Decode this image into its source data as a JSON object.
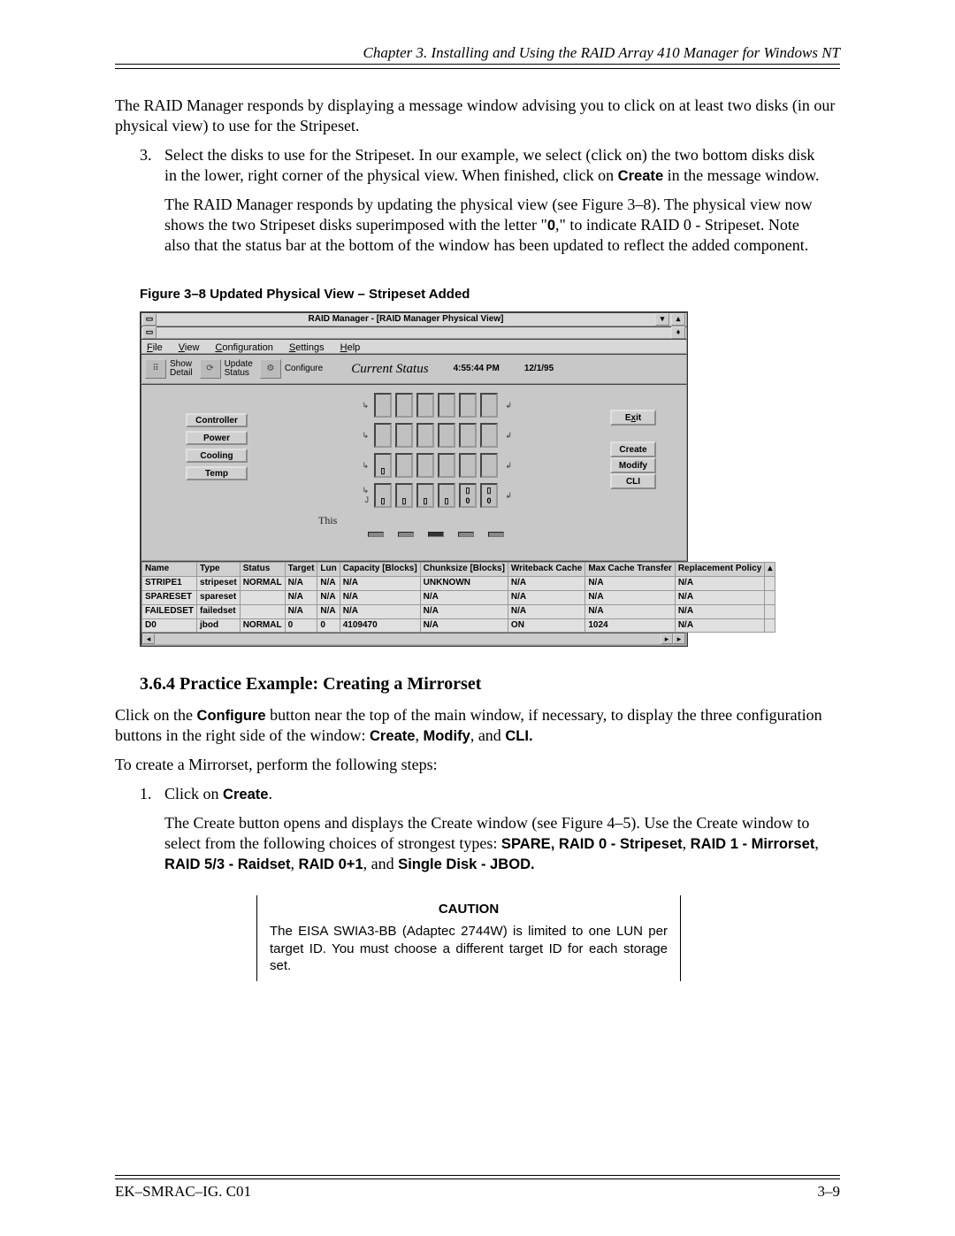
{
  "header": "Chapter 3.  Installing and Using the RAID Array 410 Manager for Windows NT",
  "intro_para1": "The RAID Manager responds by displaying a message window advising you to click on at least two disks (in our physical view) to use for the Stripeset.",
  "step3_text_a": "Select the disks to use for the Stripeset. In our example, we select (click on) the two bottom disks disk in the lower, right corner of the physical view. When finished, click on ",
  "step3_bold": "Create",
  "step3_text_b": " in the message window.",
  "step3_para2_a": "The RAID Manager responds by updating the physical view (see Figure 3–8). The physical view now shows the two Stripeset disks superimposed with the letter \"",
  "step3_para2_bold": "0",
  "step3_para2_b": ",\" to indicate RAID 0 - Stripeset. Note also that the status bar at the bottom of the window has been updated to reflect the added component.",
  "fig_caption": "Figure 3–8  Updated Physical View – Stripeset Added",
  "section_heading": "3.6.4    Practice Example: Creating a Mirrorset",
  "p1_a": "Click on the ",
  "p1_bold": "Configure",
  "p1_b": " button near the top of the main window, if necessary, to display the three configuration buttons in the right side of the window: ",
  "p1_bold2": "Create",
  "p1_comma": ", ",
  "p1_bold3": "Modify",
  "p1_and": ", and ",
  "p1_bold4": "CLI.",
  "p2": "To create a Mirrorset, perform the following steps:",
  "step1_a": "Click on ",
  "step1_bold": "Create",
  "step1_b": ".",
  "step1_para2_a": "The Create button opens and displays the Create window (see Figure 4–5). Use the Create window to select from the following choices of strongest types: ",
  "step1_para2_bold": "SPARE, RAID 0 - Stripeset",
  "step1_para2_sep1": ", ",
  "step1_para2_b2": "RAID 1 - Mirrorset",
  "step1_para2_sep2": ", ",
  "step1_para2_b3": "RAID 5/3 - Raidset",
  "step1_para2_sep3": ", ",
  "step1_para2_b4": "RAID 0+1",
  "step1_para2_sep4": ", and ",
  "step1_para2_b5": "Single Disk - JBOD.",
  "caution_title": "CAUTION",
  "caution_body": "The EISA SWIA3-BB (Adaptec 2744W) is limited to one LUN per target ID. You must choose a different target ID for each storage set.",
  "footer_left": "EK–SMRAC–IG. C01",
  "footer_right": "3–9",
  "screenshot": {
    "window_title": "RAID Manager  -  [RAID Manager Physical View]",
    "menus": {
      "file": "File",
      "view": "View",
      "config": "Configuration",
      "settings": "Settings",
      "help": "Help"
    },
    "toolbar": {
      "show_detail": "Show\nDetail",
      "update_status": "Update\nStatus",
      "configure": "Configure",
      "current_status": "Current Status",
      "time": "4:55:44 PM",
      "date": "12/1/95"
    },
    "left_buttons": {
      "controller": "Controller",
      "power": "Power",
      "cooling": "Cooling",
      "temp": "Temp"
    },
    "right_buttons": {
      "exit": "Exit",
      "create": "Create",
      "modify": "Modify",
      "cli": "CLI"
    },
    "this_label": "This",
    "table": {
      "headers": [
        "Name",
        "Type",
        "Status",
        "Target",
        "Lun",
        "Capacity [Blocks]",
        "Chunksize [Blocks]",
        "Writeback Cache",
        "Max Cache Transfer",
        "Replacement Policy"
      ],
      "rows": [
        [
          "STRIPE1",
          "stripeset",
          "NORMAL",
          "N/A",
          "N/A",
          "N/A",
          "UNKNOWN",
          "N/A",
          "N/A",
          "N/A"
        ],
        [
          "SPARESET",
          "spareset",
          "",
          "N/A",
          "N/A",
          "N/A",
          "N/A",
          "N/A",
          "N/A",
          "N/A"
        ],
        [
          "FAILEDSET",
          "failedset",
          "",
          "N/A",
          "N/A",
          "N/A",
          "N/A",
          "N/A",
          "N/A",
          "N/A"
        ],
        [
          "D0",
          "jbod",
          "NORMAL",
          "0",
          "0",
          "4109470",
          "N/A",
          "ON",
          "1024",
          "N/A"
        ]
      ]
    }
  }
}
